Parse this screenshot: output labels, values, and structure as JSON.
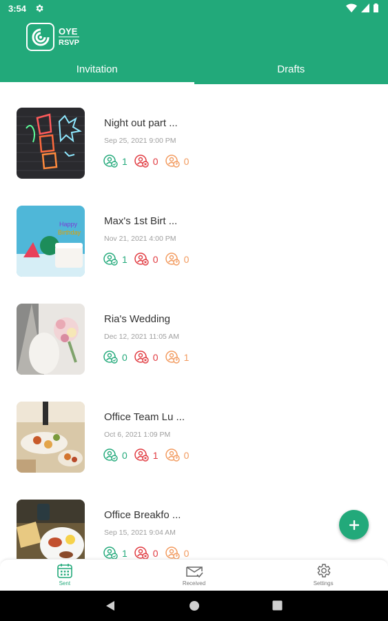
{
  "status_bar": {
    "time": "3:54"
  },
  "app": {
    "logo_line1": "OYE",
    "logo_line2": "RSVP"
  },
  "tabs": [
    {
      "label": "Invitation",
      "active": true
    },
    {
      "label": "Drafts",
      "active": false
    }
  ],
  "events": [
    {
      "title": "Night out part ...",
      "date": "Sep 25, 2021 9:00 PM",
      "attending": "1",
      "declined": "0",
      "maybe": "0"
    },
    {
      "title": "Max's 1st Birt ...",
      "date": "Nov 21, 2021 4:00 PM",
      "attending": "1",
      "declined": "0",
      "maybe": "0"
    },
    {
      "title": "Ria's Wedding",
      "date": "Dec 12, 2021 11:05 AM",
      "attending": "0",
      "declined": "0",
      "maybe": "1"
    },
    {
      "title": "Office Team Lu ...",
      "date": "Oct 6, 2021 1:09 PM",
      "attending": "0",
      "declined": "1",
      "maybe": "0"
    },
    {
      "title": "Office Breakfo ...",
      "date": "Sep 15, 2021 9:04 AM",
      "attending": "1",
      "declined": "0",
      "maybe": "0"
    }
  ],
  "bottom_nav": [
    {
      "label": "Sent",
      "icon": "calendar-icon",
      "active": true
    },
    {
      "label": "Received",
      "icon": "mail-check-icon",
      "active": false
    },
    {
      "label": "Settings",
      "icon": "gear-icon",
      "active": false
    }
  ],
  "colors": {
    "primary": "#22a97a",
    "declined": "#e0383e",
    "maybe": "#f29a5e"
  }
}
